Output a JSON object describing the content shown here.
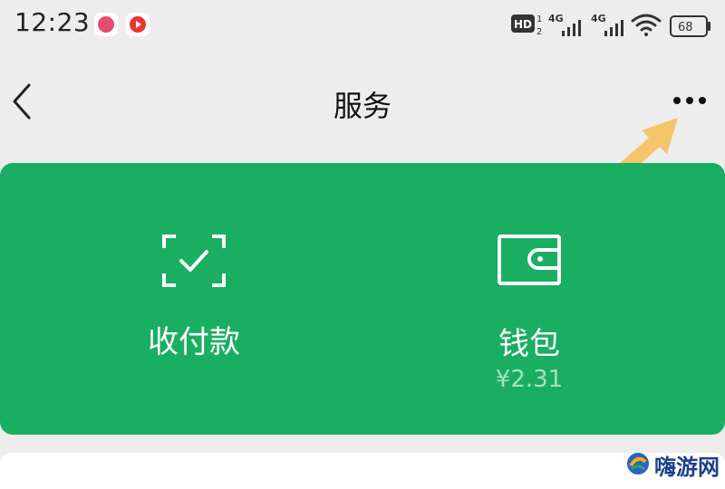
{
  "status_bar": {
    "time": "12:23",
    "apps": [
      "pink-app-icon",
      "red-video-app-icon"
    ],
    "network_1": "4G",
    "network_2": "4G",
    "hd_label": "HD",
    "battery": "68"
  },
  "nav": {
    "title": "服务"
  },
  "service_card": {
    "pay_label": "收付款",
    "wallet_label": "钱包",
    "wallet_balance": "¥2.31"
  },
  "colors": {
    "card_green": "#1aae62",
    "background": "#ededed",
    "annotation_arrow": "#f5c56c"
  },
  "watermark": {
    "text": "嗨游网"
  }
}
